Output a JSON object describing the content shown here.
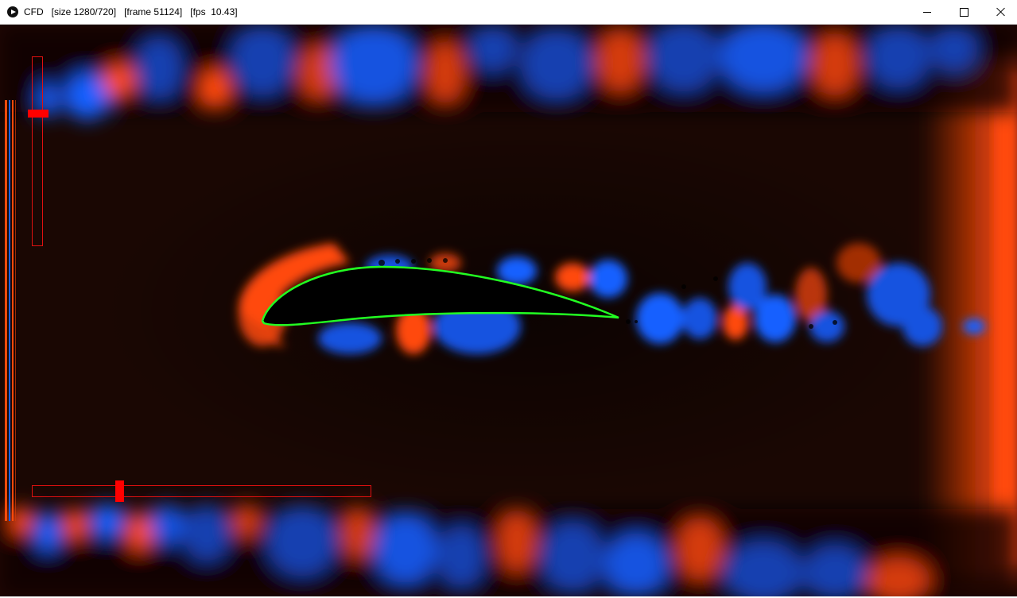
{
  "window": {
    "app_name": "CFD",
    "size_label": "[size 1280/720]",
    "frame_label": "[frame 51124]",
    "fps_label": "[fps  10.43]",
    "app_icon": "play-circle-icon",
    "controls": {
      "minimize_icon": "minimize-icon",
      "maximize_icon": "maximize-icon",
      "close_icon": "close-icon"
    }
  },
  "simulation": {
    "colors": {
      "background": "#120602",
      "positive_vorticity": "#ff4a0a",
      "negative_vorticity": "#1560ff",
      "airfoil_fill": "#000000",
      "airfoil_outline": "#22ff22",
      "slider_color": "#ff0000"
    },
    "vertical_slider": {
      "value": 0.22
    },
    "horizontal_slider": {
      "value": 0.26
    }
  }
}
